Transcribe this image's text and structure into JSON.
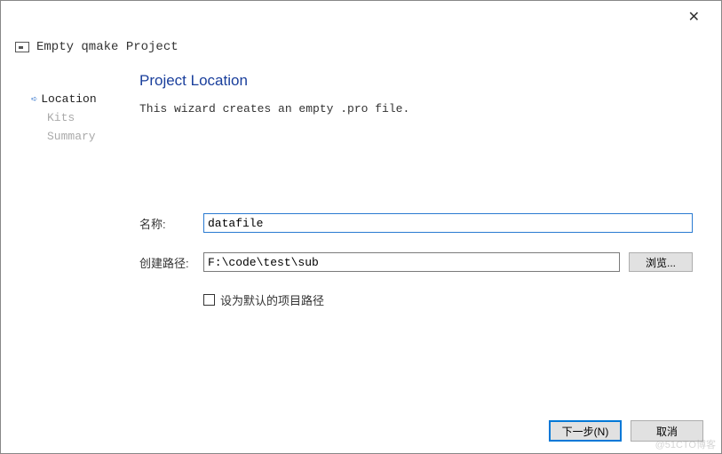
{
  "window": {
    "title": "Empty qmake Project"
  },
  "sidebar": {
    "items": [
      {
        "label": "Location",
        "active": true
      },
      {
        "label": "Kits",
        "active": false
      },
      {
        "label": "Summary",
        "active": false
      }
    ]
  },
  "main": {
    "heading": "Project Location",
    "description": "This wizard creates an empty .pro file.",
    "name_label": "名称:",
    "name_value": "datafile",
    "path_label": "创建路径:",
    "path_value": "F:\\code\\test\\sub",
    "browse_label": "浏览...",
    "default_path_label": "设为默认的项目路径"
  },
  "footer": {
    "next_label": "下一步(N)",
    "cancel_label": "取消"
  },
  "watermark": "@51CTO博客"
}
